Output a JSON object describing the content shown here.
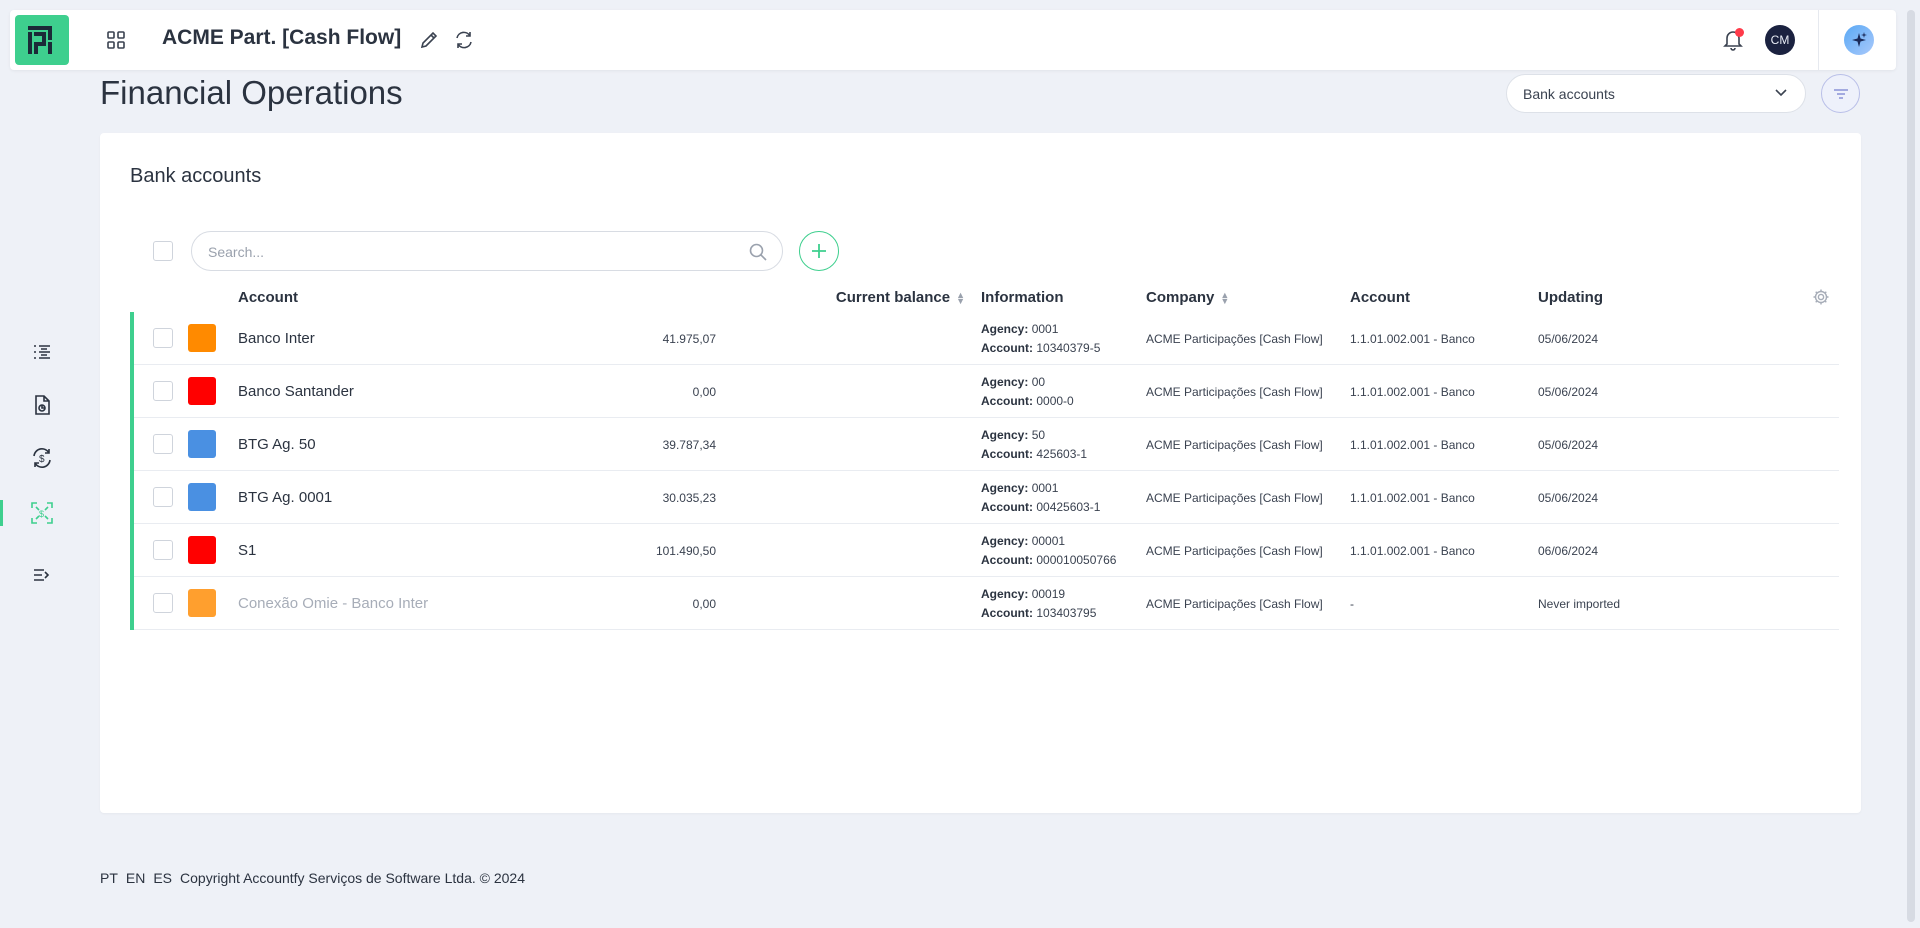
{
  "header": {
    "title": "ACME Part. [Cash Flow]",
    "avatar_initials": "CM",
    "logo_color": "#3ecf8e",
    "has_notification": true
  },
  "page": {
    "title": "Financial Operations",
    "view_select": "Bank accounts"
  },
  "card": {
    "title": "Bank accounts",
    "search_placeholder": "Search..."
  },
  "table": {
    "columns": {
      "account": "Account",
      "balance": "Current balance",
      "information": "Information",
      "company": "Company",
      "ledger_account": "Account",
      "updating": "Updating"
    },
    "agency_label": "Agency:",
    "account_label": "Account:",
    "rows": [
      {
        "name": "Banco Inter",
        "color": "#ff8a00",
        "balance": "41.975,07",
        "agency": "0001",
        "account": "10340379-5",
        "company": "ACME Participações [Cash Flow]",
        "ledger": "1.1.01.002.001 - Banco",
        "updated": "05/06/2024"
      },
      {
        "name": "Banco Santander",
        "color": "#ff0000",
        "balance": "0,00",
        "agency": "00",
        "account": "0000-0",
        "company": "ACME Participações [Cash Flow]",
        "ledger": "1.1.01.002.001 - Banco",
        "updated": "05/06/2024"
      },
      {
        "name": "BTG Ag. 50",
        "color": "#4a90e2",
        "balance": "39.787,34",
        "agency": "50",
        "account": "425603-1",
        "company": "ACME Participações [Cash Flow]",
        "ledger": "1.1.01.002.001 - Banco",
        "updated": "05/06/2024"
      },
      {
        "name": "BTG Ag. 0001",
        "color": "#4a90e2",
        "balance": "30.035,23",
        "agency": "0001",
        "account": "00425603-1",
        "company": "ACME Participações [Cash Flow]",
        "ledger": "1.1.01.002.001 - Banco",
        "updated": "05/06/2024"
      },
      {
        "name": "S1",
        "color": "#ff0000",
        "balance": "101.490,50",
        "agency": "00001",
        "account": "000010050766",
        "company": "ACME Participações [Cash Flow]",
        "ledger": "1.1.01.002.001 - Banco",
        "updated": "06/06/2024"
      },
      {
        "name": "Conexão Omie - Banco Inter",
        "color": "#ff9f2e",
        "balance": "0,00",
        "agency": "00019",
        "account": "103403795",
        "company": "ACME Participações [Cash Flow]",
        "ledger": "-",
        "updated": "Never imported",
        "muted": true
      }
    ]
  },
  "footer": {
    "lang_pt": "PT",
    "lang_en": "EN",
    "lang_es": "ES",
    "copyright": "Copyright Accountfy Serviços de Software Ltda. © 2024"
  },
  "icons": {
    "sidebar": [
      "list-icon",
      "report-icon",
      "cash-cycle-icon",
      "bank-accounts-icon",
      "collapse-menu-icon"
    ]
  }
}
